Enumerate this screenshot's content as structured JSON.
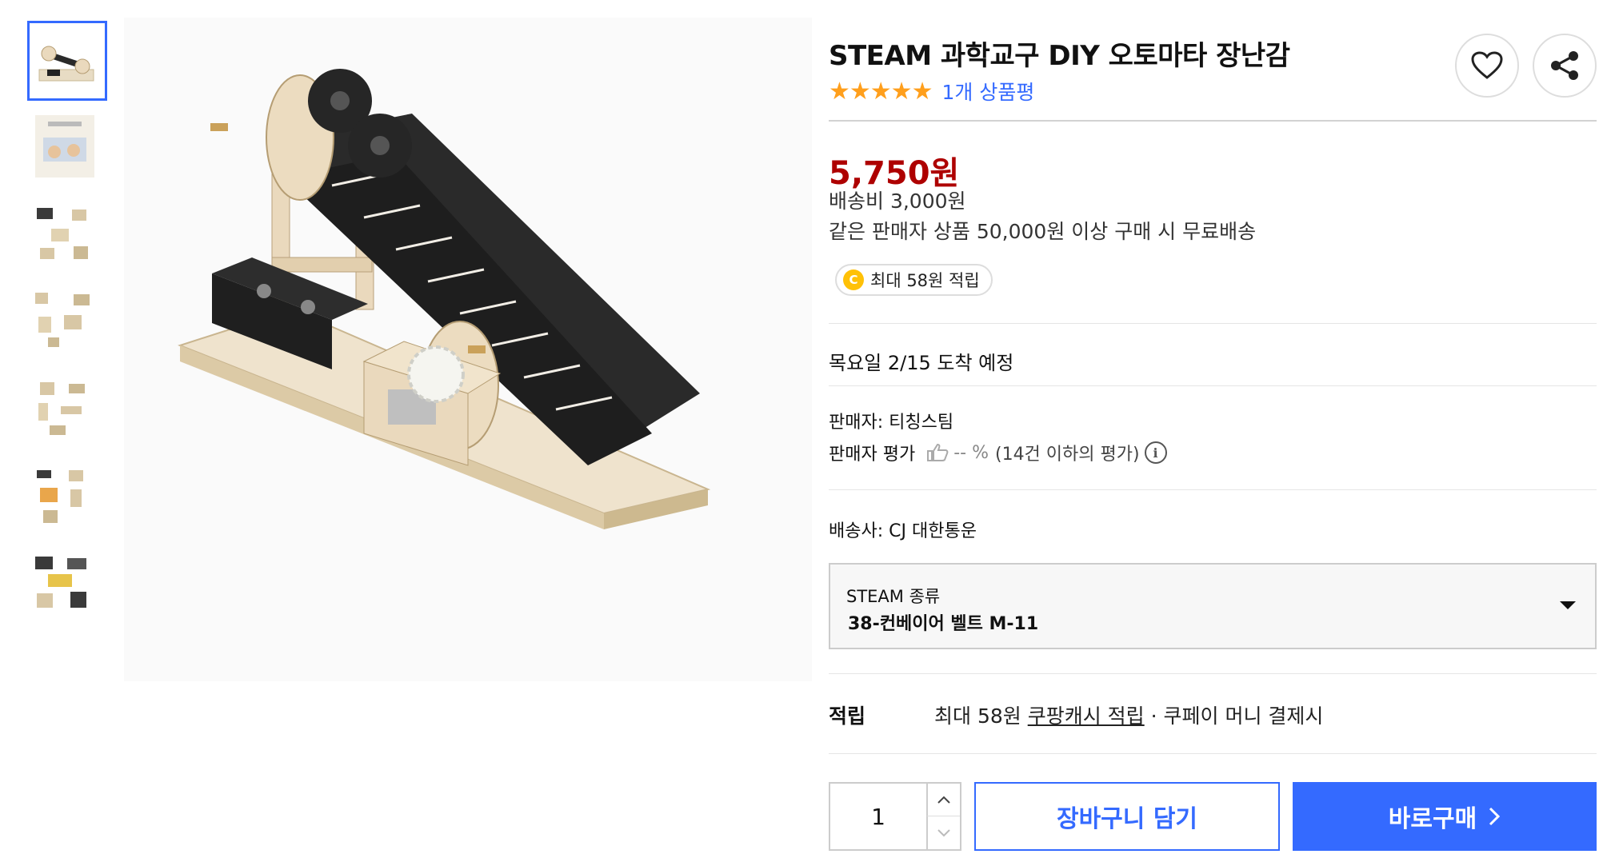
{
  "gallery": {
    "thumbnail_count": 7,
    "active_index": 0,
    "main_image_alt": "wooden conveyor belt automata kit"
  },
  "product": {
    "title": "STEAM 과학교구 DIY 오토마타 장난감",
    "rating_stars": "★★★★★",
    "review_count_label": "1개 상품평"
  },
  "price": {
    "sale_price": "5,750원",
    "shipping_fee": "배송비 3,000원",
    "free_shipping_note": "같은 판매자 상품 50,000원 이상 구매 시 무료배송",
    "cash_badge_coin": "C",
    "cash_badge_label": "최대 58원 적립"
  },
  "delivery": {
    "arrival": "목요일 2/15 도착 예정"
  },
  "seller": {
    "name_line": "판매자: 티칭스팀",
    "rating_label": "판매자 평가",
    "rating_value": "-- %",
    "rating_note": "(14건 이하의 평가)",
    "info_glyph": "i",
    "carrier": "배송사: CJ 대한통운"
  },
  "option": {
    "label": "STEAM 종류",
    "selected": "38-컨베이어 벨트 M-11"
  },
  "reward": {
    "label": "적립",
    "prefix": "최대 58원",
    "link": "쿠팡캐시 적립",
    "suffix": "· 쿠페이 머니 결제시"
  },
  "purchase": {
    "quantity": "1",
    "cart_button": "장바구니 담기",
    "buy_button": "바로구매"
  },
  "icons": {
    "wishlist": "heart-icon",
    "share": "share-icon",
    "caret": "chevron-down-icon",
    "buy_arrow": "chevron-right-icon"
  },
  "colors": {
    "accent": "#346aff",
    "price": "#ae0000",
    "stars": "#ff9f1c",
    "coin": "#ffc107"
  }
}
